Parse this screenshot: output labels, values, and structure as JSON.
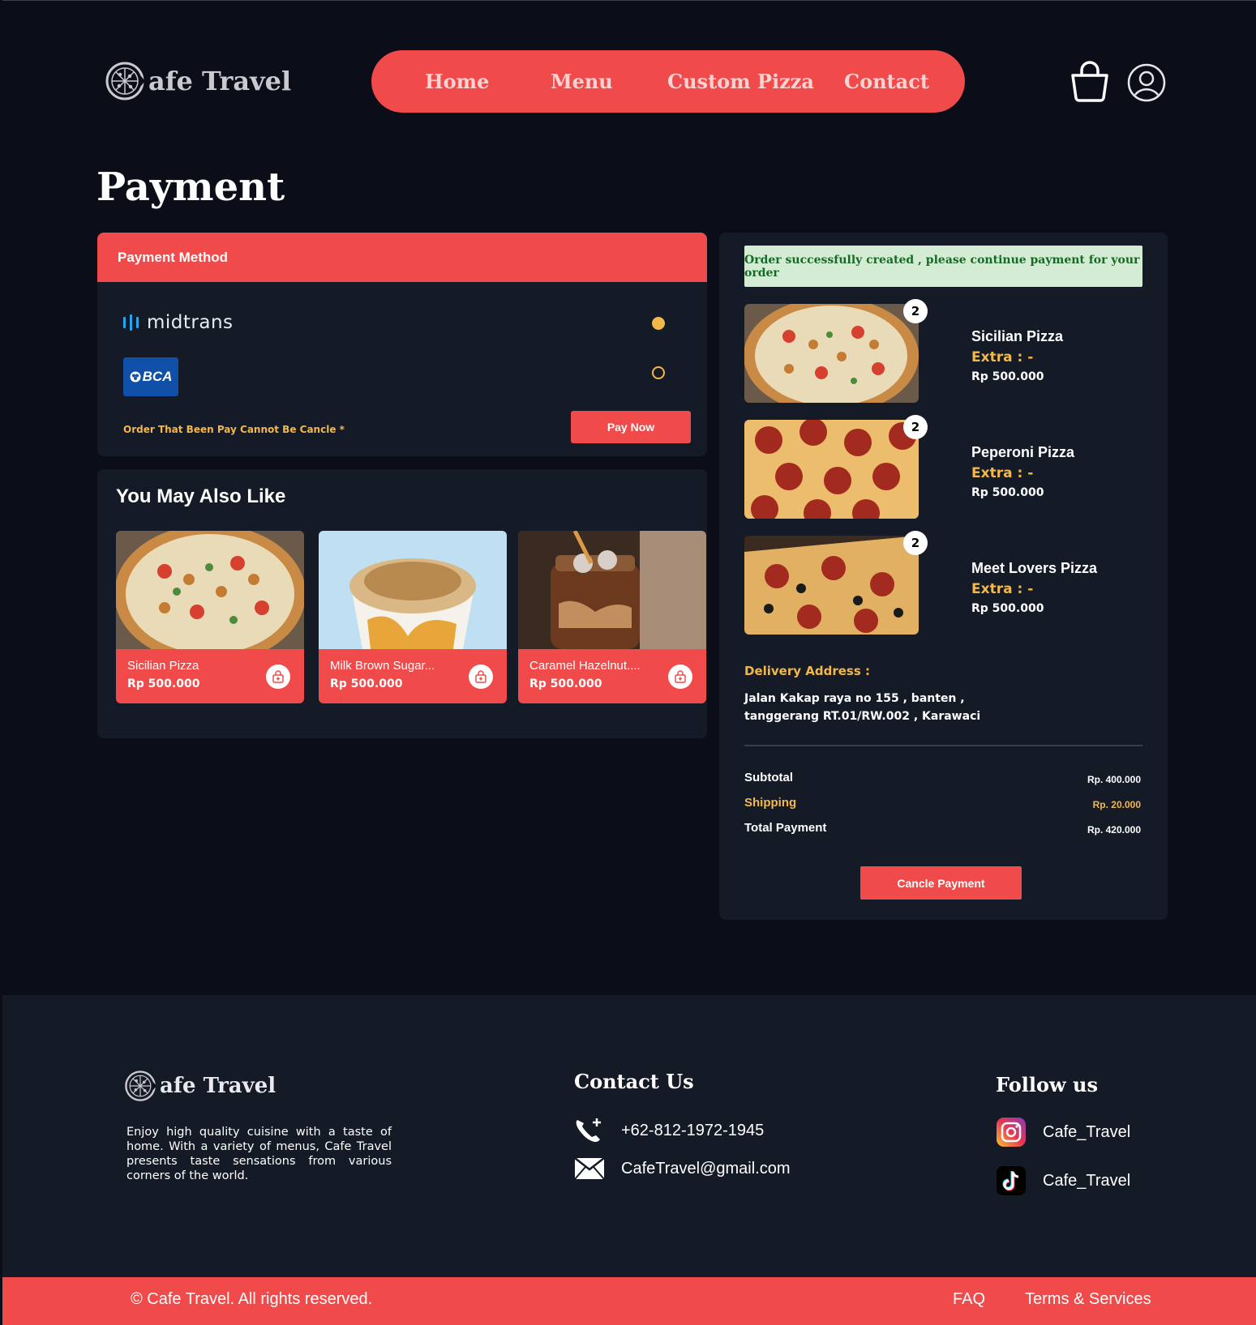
{
  "brand": {
    "name": "afe Travel",
    "logo_icon": "pizza-c-icon"
  },
  "nav": {
    "items": [
      "Home",
      "Menu",
      "Custom Pizza",
      "Contact"
    ]
  },
  "header_icons": {
    "cart": "shopping-bag-icon",
    "user": "user-circle-icon"
  },
  "page_title": "Payment",
  "payment": {
    "heading": "Payment Method",
    "methods": [
      {
        "name": "midtrans",
        "selected": true
      },
      {
        "name": "BCA",
        "selected": false
      }
    ],
    "warning": "Order That Been Pay Cannot Be Cancle *",
    "pay_button": "Pay Now"
  },
  "recommendations": {
    "title": "You May Also Like",
    "items": [
      {
        "name": "Sicilian Pizza",
        "price": "Rp 500.000"
      },
      {
        "name": "Milk Brown Sugar...",
        "price": "Rp 500.000"
      },
      {
        "name": "Caramel Hazelnut....",
        "price": "Rp 500.000"
      }
    ]
  },
  "order": {
    "success_message": "Order successfully created , please continue payment for your order",
    "items": [
      {
        "qty": "2",
        "name": "Sicilian Pizza",
        "extra": "Extra : -",
        "price": "Rp 500.000"
      },
      {
        "qty": "2",
        "name": "Peperoni Pizza",
        "extra": "Extra : -",
        "price": "Rp 500.000"
      },
      {
        "qty": "2",
        "name": "Meet Lovers Pizza",
        "extra": "Extra : -",
        "price": "Rp 500.000"
      }
    ],
    "address_label": "Delivery Address :",
    "address_line1": "Jalan Kakap raya no 155 , banten ,",
    "address_line2": "tanggerang RT.01/RW.002 , Karawaci",
    "summary": {
      "subtotal_label": "Subtotal",
      "subtotal": "Rp. 400.000",
      "shipping_label": "Shipping",
      "shipping": "Rp. 20.000",
      "total_label": "Total Payment",
      "total": "Rp. 420.000"
    },
    "cancel_button": "Cancle Payment"
  },
  "footer": {
    "brand": "afe Travel",
    "description": "Enjoy high quality cuisine with a taste of home. With a variety of menus, Cafe Travel presents taste sensations from various corners of the world.",
    "contact_heading": "Contact Us",
    "phone": "+62-812-1972-1945",
    "email": "CafeTravel@gmail.com",
    "follow_heading": "Follow us",
    "instagram": "Cafe_Travel",
    "tiktok": "Cafe_Travel",
    "copyright": "© Cafe Travel. All rights reserved.",
    "faq": "FAQ",
    "terms": "Terms & Services"
  },
  "colors": {
    "accent": "#f04a4a",
    "gold": "#f2b84b",
    "background": "#0b0e18",
    "panel": "#151a27",
    "success_bg": "#d4ecd4",
    "success_text": "#166a25"
  }
}
